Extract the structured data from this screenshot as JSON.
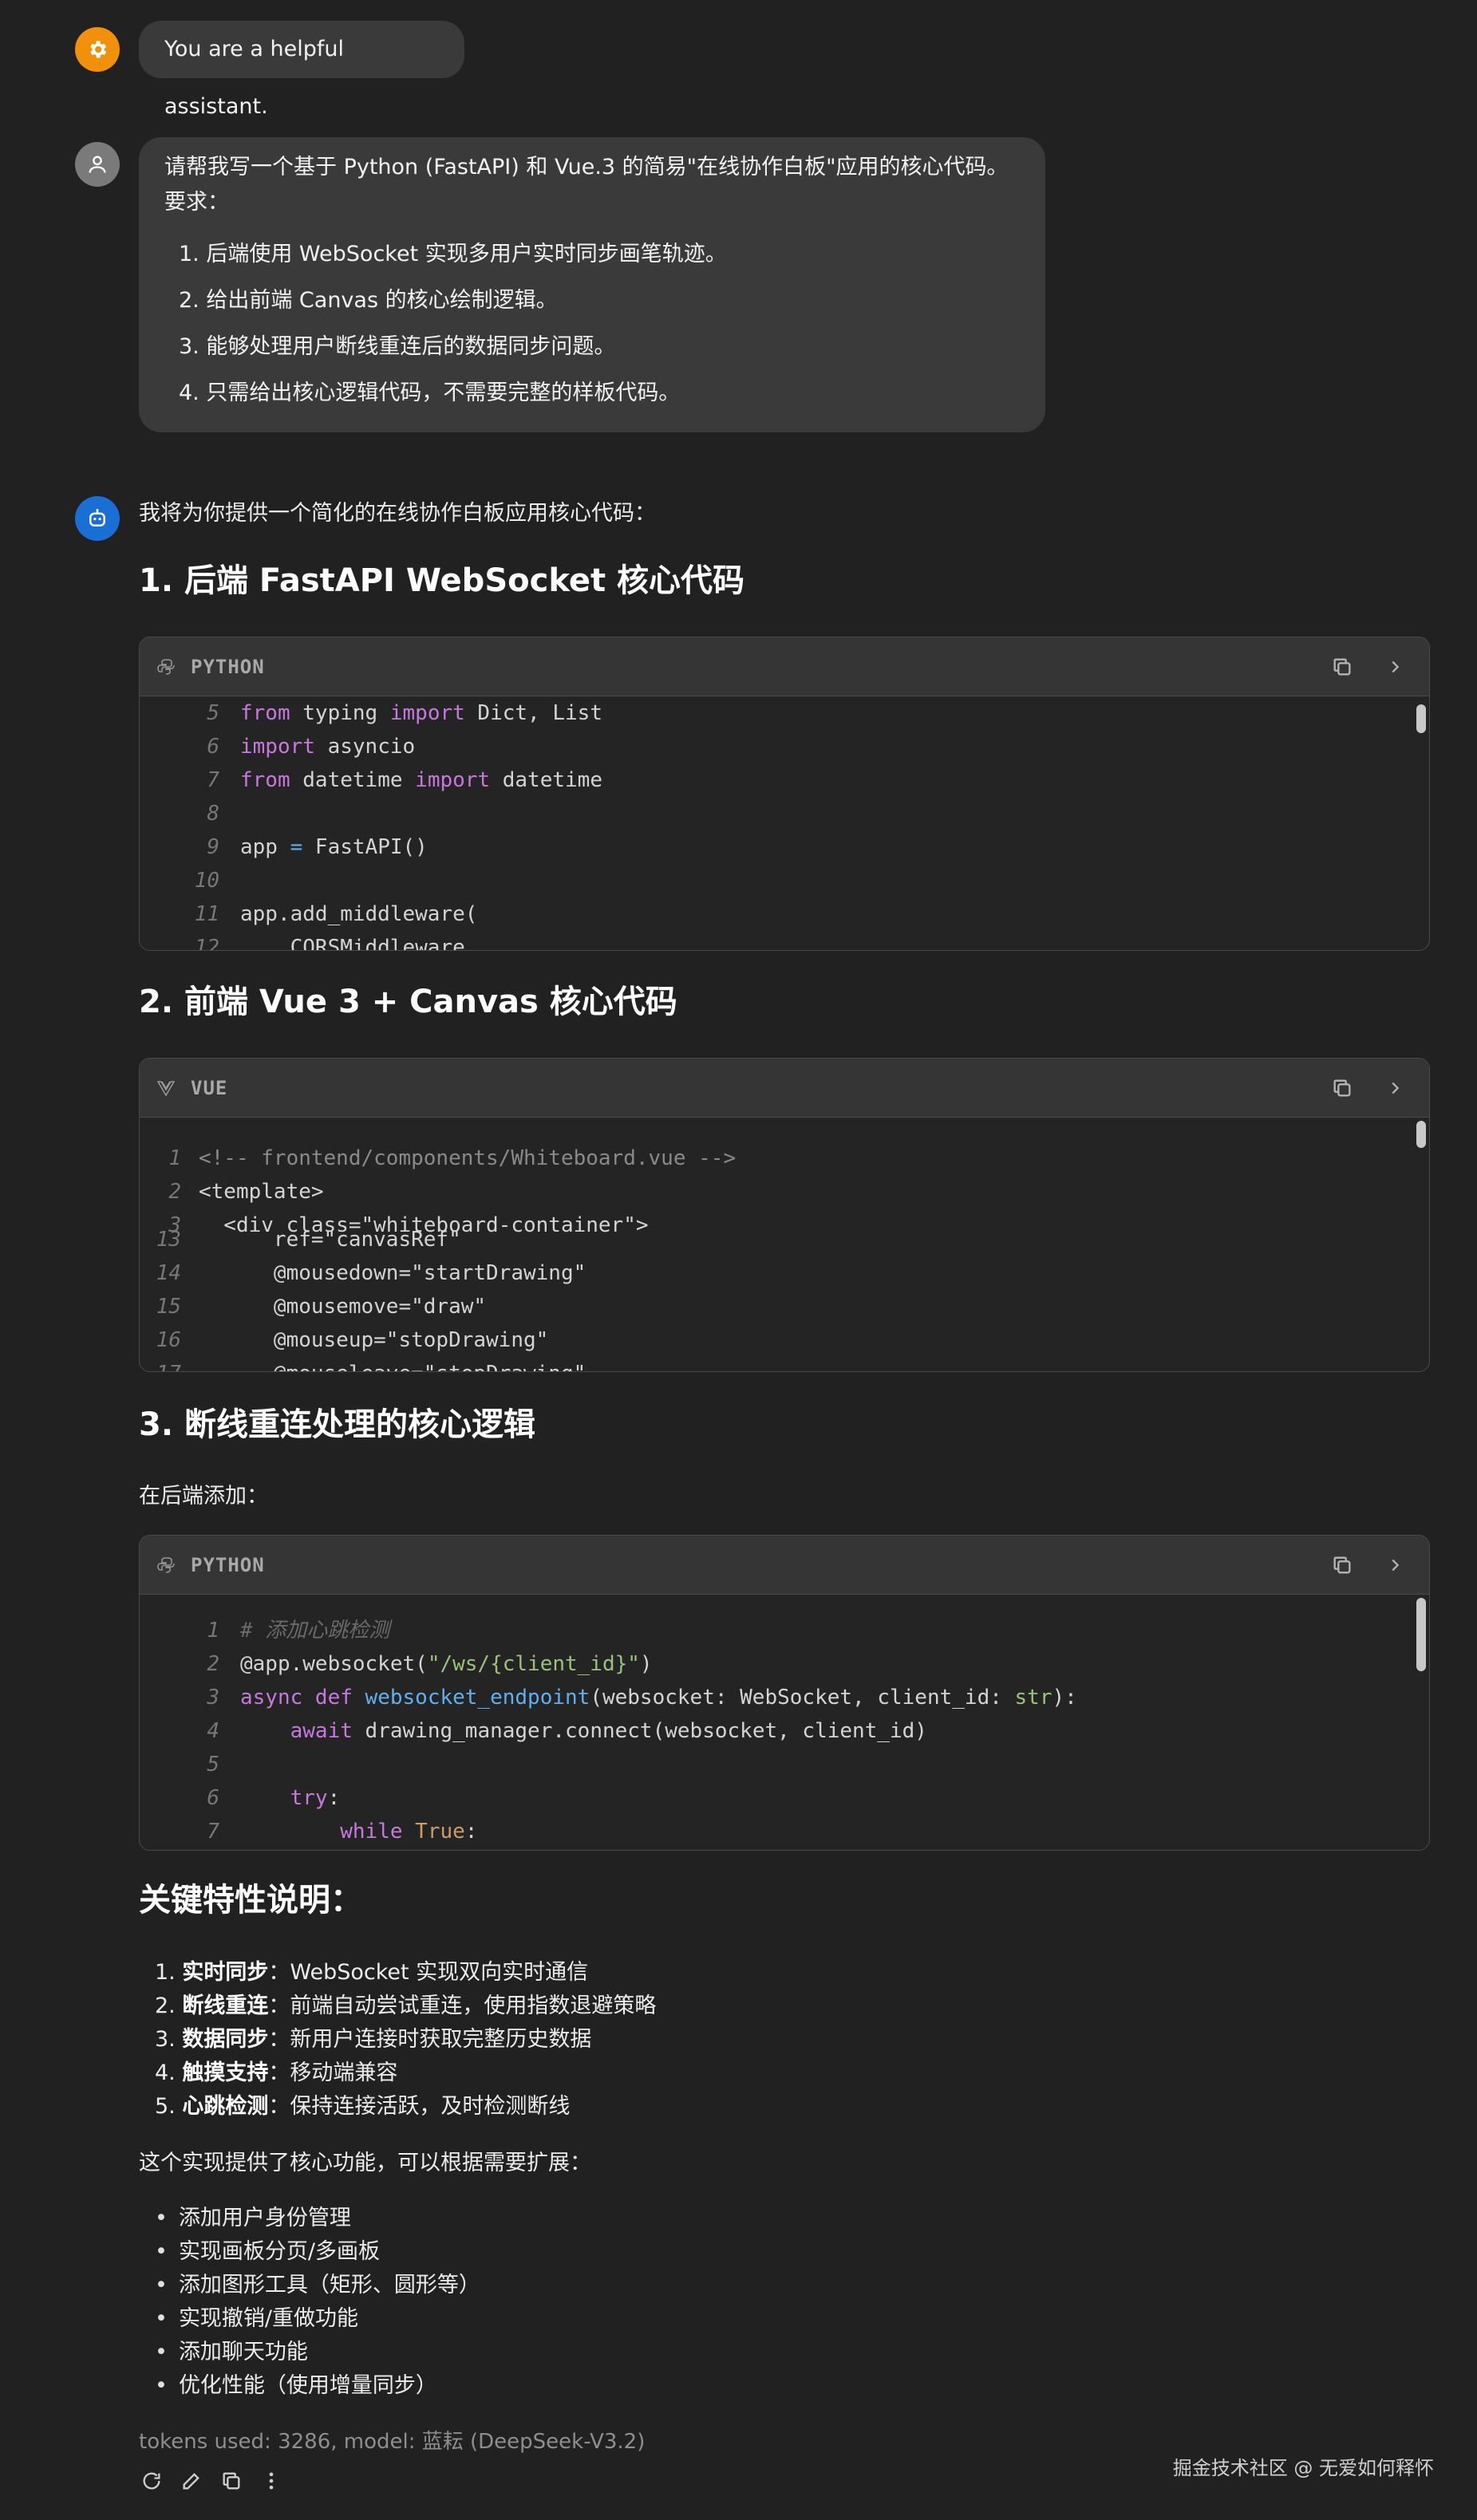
{
  "system": {
    "avatar_icon": "gear-icon",
    "text": "You are a helpful assistant."
  },
  "user": {
    "avatar_icon": "user-icon",
    "line1": "请帮我写一个基于 Python (FastAPI) 和 Vue.3 的简易\"在线协作白板\"应用的核心代码。",
    "line2": "要求：",
    "requirements": [
      "1. 后端使用 WebSocket 实现多用户实时同步画笔轨迹。",
      "2. 给出前端 Canvas 的核心绘制逻辑。",
      "3. 能够处理用户断线重连后的数据同步问题。",
      "4. 只需给出核心逻辑代码，不需要完整的样板代码。"
    ]
  },
  "assistant": {
    "avatar_icon": "robot-icon",
    "intro": "我将为你提供一个简化的在线协作白板应用核心代码：",
    "sections": [
      {
        "heading": "1. 后端 FastAPI WebSocket 核心代码"
      },
      {
        "heading": "2. 前端 Vue 3 + Canvas 核心代码"
      },
      {
        "heading": "3. 断线重连处理的核心逻辑",
        "note": "在后端添加："
      }
    ],
    "code_blocks": [
      {
        "lang": "PYTHON",
        "lang_icon": "python-icon",
        "lines": [
          {
            "n": "5",
            "html": "<span class=\"kw\">from</span> typing <span class=\"kw\">import</span> Dict, List"
          },
          {
            "n": "6",
            "html": "<span class=\"kw\">import</span> asyncio"
          },
          {
            "n": "7",
            "html": "<span class=\"kw\">from</span> datetime <span class=\"kw\">import</span> datetime"
          },
          {
            "n": "8",
            "html": ""
          },
          {
            "n": "9",
            "html": "app <span class=\"fn\">=</span> FastAPI()"
          },
          {
            "n": "10",
            "html": ""
          },
          {
            "n": "11",
            "html": "app.add_middleware("
          },
          {
            "n": "12",
            "html": "    CORSMiddleware,"
          }
        ]
      },
      {
        "lang": "VUE",
        "lang_icon": "vue-icon",
        "lines": [
          {
            "n": "1",
            "html": "<span class=\"cmt\" style=\"font-style:normal;color:#8a8a8a\">&lt;!-- frontend/components/Whiteboard.vue --&gt;</span>"
          },
          {
            "n": "2",
            "html": "&lt;template&gt;"
          },
          {
            "n": "3",
            "html": "  &lt;div class=\"whiteboard-container\"&gt;"
          },
          {
            "n": "13",
            "html": "      ref=\"canvasRef\""
          },
          {
            "n": "14",
            "html": "      @mousedown=\"startDrawing\""
          },
          {
            "n": "15",
            "html": "      @mousemove=\"draw\""
          },
          {
            "n": "16",
            "html": "      @mouseup=\"stopDrawing\""
          },
          {
            "n": "17",
            "html": "      @mouseleave=\"stopDrawing\""
          }
        ]
      },
      {
        "lang": "PYTHON",
        "lang_icon": "python-icon",
        "lines": [
          {
            "n": "1",
            "html": "<span class=\"cmt\"># 添加心跳检测</span>"
          },
          {
            "n": "2",
            "html": "@app.websocket(<span class=\"str\">\"/ws/{client_id}\"</span>)"
          },
          {
            "n": "3",
            "html": "<span class=\"kw\">async def</span> <span class=\"fn\">websocket_endpoint</span>(websocket: WebSocket, client_id: <span class=\"str\">str</span>):"
          },
          {
            "n": "4",
            "html": "    <span class=\"kw\">await</span> drawing_manager.connect(websocket, client_id)"
          },
          {
            "n": "5",
            "html": ""
          },
          {
            "n": "6",
            "html": "    <span class=\"kw\">try</span>:"
          },
          {
            "n": "7",
            "html": "        <span class=\"kw\">while</span> <span class=\"num\">True</span>:"
          }
        ]
      }
    ],
    "features_title": "关键特性说明：",
    "features": [
      {
        "num": "1.",
        "bold": "实时同步",
        "text": "：WebSocket 实现双向实时通信"
      },
      {
        "num": "2.",
        "bold": "断线重连",
        "text": "：前端自动尝试重连，使用指数退避策略"
      },
      {
        "num": "3.",
        "bold": "数据同步",
        "text": "：新用户连接时获取完整历史数据"
      },
      {
        "num": "4.",
        "bold": "触摸支持",
        "text": "：移动端兼容"
      },
      {
        "num": "5.",
        "bold": "心跳检测",
        "text": "：保持连接活跃，及时检测断线"
      }
    ],
    "summary": "这个实现提供了核心功能，可以根据需要扩展：",
    "extensions": [
      "添加用户身份管理",
      "实现画板分页/多画板",
      "添加图形工具（矩形、圆形等）",
      "实现撤销/重做功能",
      "添加聊天功能",
      "优化性能（使用增量同步）"
    ],
    "tokens": "tokens used: 3286, model: 蓝耘 (DeepSeek-V3.2)"
  },
  "toolbar_icons": [
    "refresh-icon",
    "edit-icon",
    "copy-icon",
    "more-icon"
  ],
  "watermark": "掘金技术社区 @ 无爱如何释怀",
  "colors": {
    "background": "#212121",
    "bubble": "#3a3a3a",
    "system_avatar": "#f0900b",
    "user_avatar": "#7a7a7a",
    "assistant_avatar": "#1a6fd4",
    "keyword": "#c678dd",
    "function": "#61afef",
    "string": "#98c379"
  }
}
